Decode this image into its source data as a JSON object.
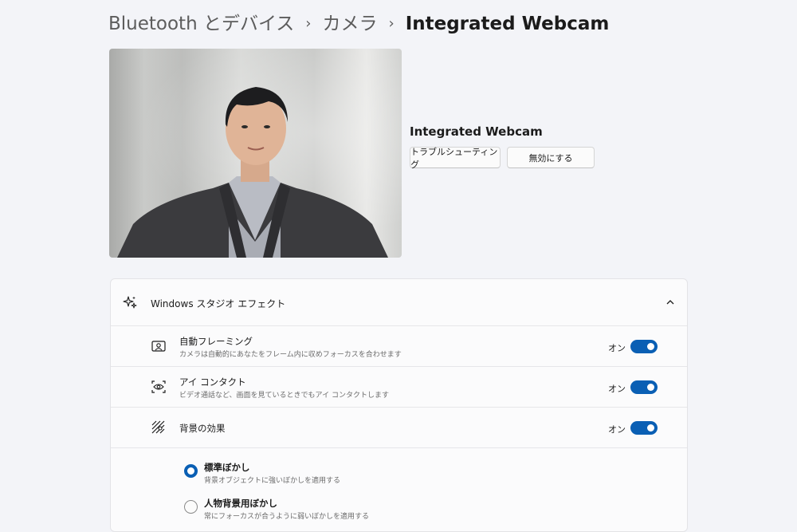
{
  "breadcrumb": {
    "level1": "Bluetooth とデバイス",
    "separator": "›",
    "level2": "カメラ",
    "current": "Integrated Webcam"
  },
  "device": {
    "name": "Integrated Webcam",
    "troubleshoot_label": "トラブルシューティング",
    "disable_label": "無効にする"
  },
  "studio_effects": {
    "title": "Windows スタジオ エフェクト",
    "expanded": true,
    "items": [
      {
        "title": "自動フレーミング",
        "subtitle": "カメラは自動的にあなたをフレーム内に収めフォーカスを合わせます",
        "state_label": "オン",
        "enabled": true,
        "icon": "framing-icon"
      },
      {
        "title": "アイ コンタクト",
        "subtitle": "ビデオ通話など、画面を見ているときでもアイ コンタクトします",
        "state_label": "オン",
        "enabled": true,
        "icon": "eye-contact-icon"
      },
      {
        "title": "背景の効果",
        "state_label": "オン",
        "enabled": true,
        "icon": "background-effects-icon"
      }
    ],
    "background_options": [
      {
        "title": "標準ぼかし",
        "subtitle": "背景オブジェクトに強いぼかしを適用する",
        "selected": true
      },
      {
        "title": "人物背景用ぼかし",
        "subtitle": "常にフォーカスが合うように弱いぼかしを適用する",
        "selected": false
      }
    ]
  },
  "colors": {
    "accent": "#0a5fb4",
    "background": "#f3f4f8",
    "card": "#fbfbfc"
  }
}
